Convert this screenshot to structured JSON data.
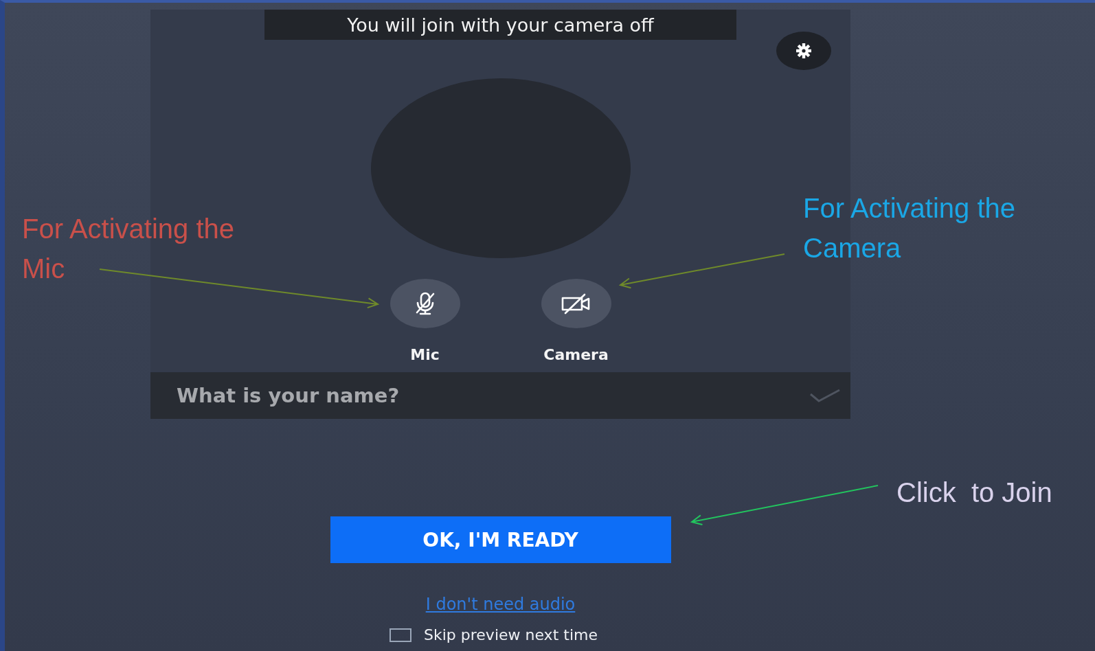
{
  "banner": "You will join with your camera off",
  "devices": [
    {
      "kind": "mic",
      "label": "Mic",
      "muted": true
    },
    {
      "kind": "camera",
      "label": "Camera",
      "muted": true
    }
  ],
  "name_field": {
    "placeholder": "What is your name?"
  },
  "join_button": "OK, I'M READY",
  "audio_link": "I don't need audio",
  "skip_preview": {
    "label": "Skip preview next time",
    "checked": false
  },
  "annotations": [
    {
      "kind": "mic",
      "text": "For Activating the Mic",
      "color": "#c9504a"
    },
    {
      "kind": "camera",
      "text": "For Activating the Camera",
      "color": "#1aa7e6"
    },
    {
      "kind": "join",
      "text": "Click  to Join",
      "color": "#d9d2ec"
    }
  ]
}
